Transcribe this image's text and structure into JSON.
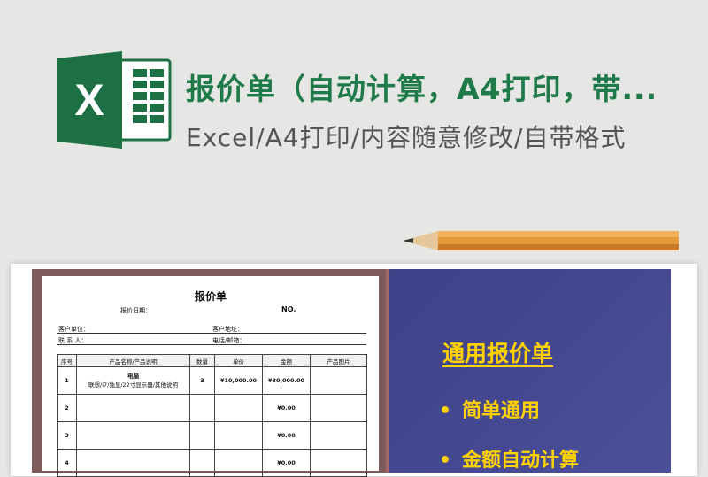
{
  "header": {
    "title": "报价单（自动计算，A4打印，带...",
    "subtitle": "Excel/A4打印/内容随意修改/自带格式",
    "logo_letter": "X",
    "logo_color": "#1d7044"
  },
  "sheet": {
    "title": "报价单",
    "date_label": "报价日期：",
    "no_label": "NO.",
    "customer_label": "客户单位：",
    "address_label": "客户地址：",
    "contact_label": "联  系  人：",
    "phone_label": "电话/邮箱：",
    "columns": [
      "序号",
      "产品名称/产品说明",
      "数量",
      "单价",
      "金额",
      "产品图片"
    ],
    "rows": [
      {
        "no": "1",
        "name": "电脑",
        "desc": "联想/i7/独显/22寸显示器/其他说明",
        "qty": "3",
        "price": "¥10,000.00",
        "amount": "¥30,000.00"
      },
      {
        "no": "2",
        "name": "",
        "desc": "",
        "qty": "",
        "price": "",
        "amount": "¥0.00"
      },
      {
        "no": "3",
        "name": "",
        "desc": "",
        "qty": "",
        "price": "",
        "amount": "¥0.00"
      },
      {
        "no": "4",
        "name": "",
        "desc": "",
        "qty": "",
        "price": "",
        "amount": "¥0.00"
      }
    ]
  },
  "promo": {
    "headline": "通用报价单",
    "bullet_char": "•",
    "bullets": [
      "简单通用",
      "金额自动计算"
    ],
    "accent_color": "#ffd200"
  }
}
